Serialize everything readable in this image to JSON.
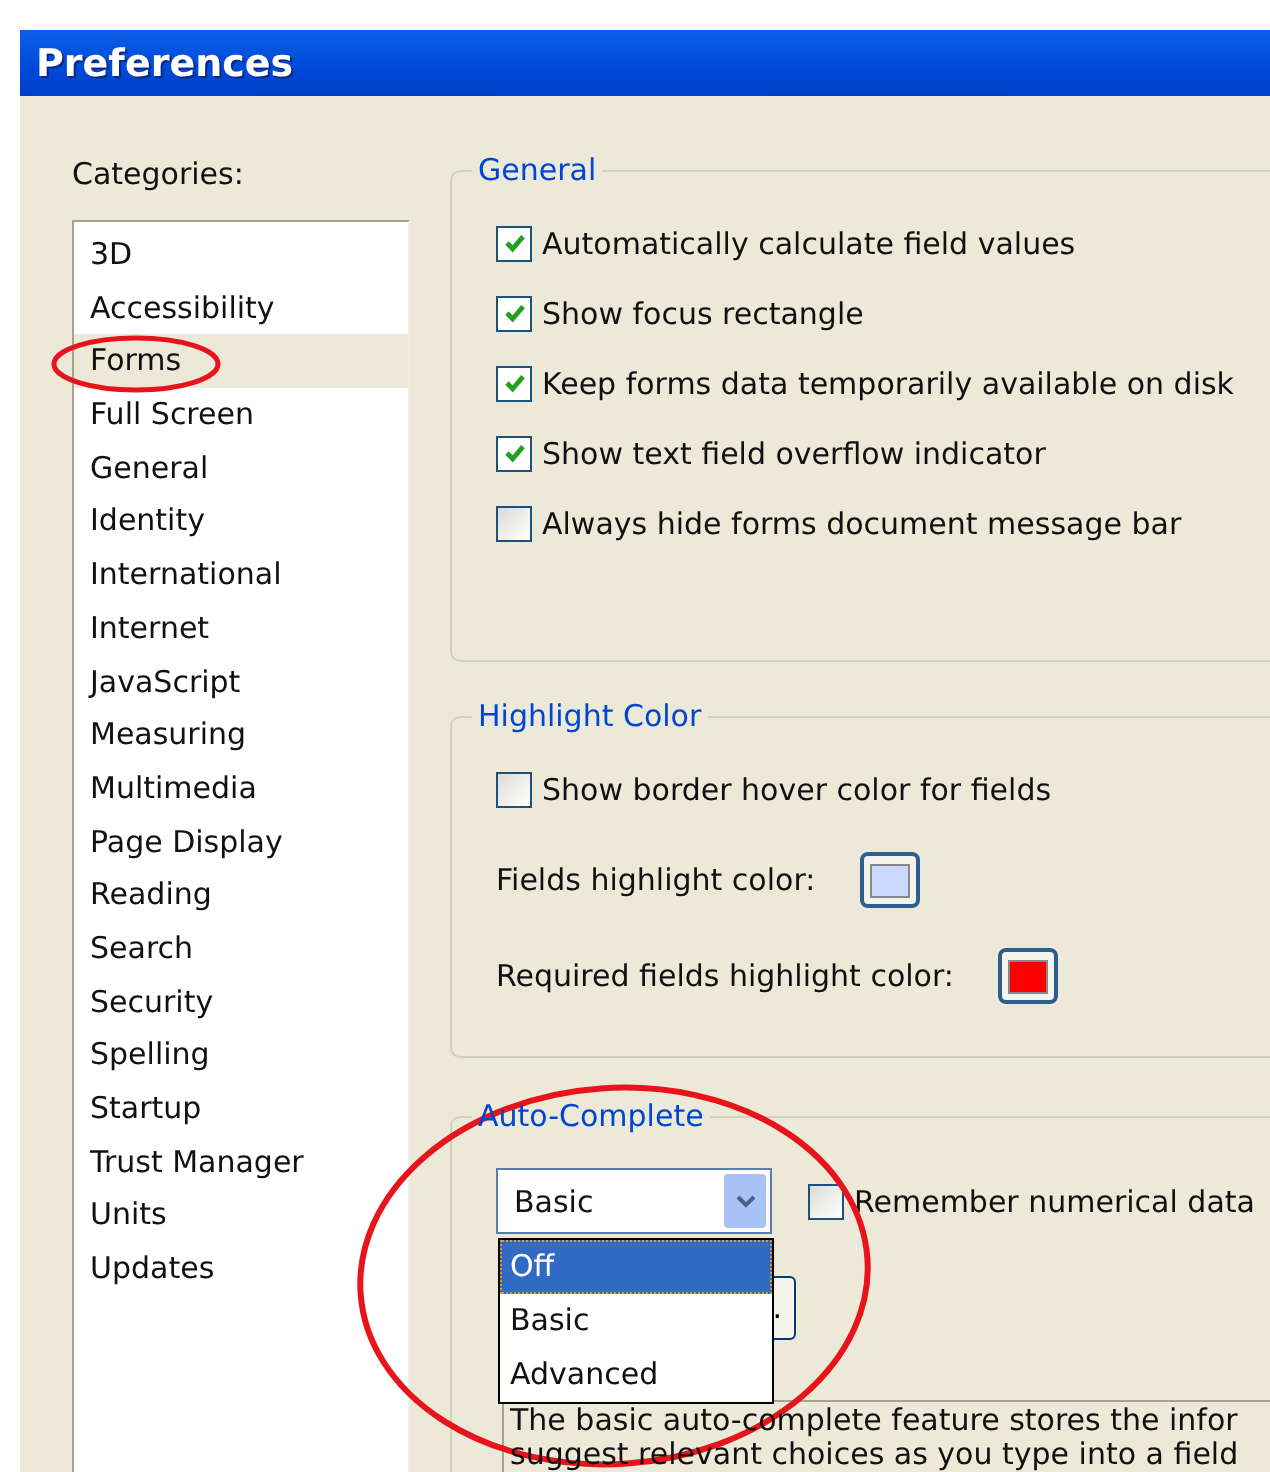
{
  "window": {
    "title": "Preferences"
  },
  "categories": {
    "label": "Categories:",
    "items": [
      {
        "label": "3D",
        "selected": false
      },
      {
        "label": "Accessibility",
        "selected": false
      },
      {
        "label": "Forms",
        "selected": true
      },
      {
        "label": "Full Screen",
        "selected": false
      },
      {
        "label": "General",
        "selected": false
      },
      {
        "label": "Identity",
        "selected": false
      },
      {
        "label": "International",
        "selected": false
      },
      {
        "label": "Internet",
        "selected": false
      },
      {
        "label": "JavaScript",
        "selected": false
      },
      {
        "label": "Measuring",
        "selected": false
      },
      {
        "label": "Multimedia",
        "selected": false
      },
      {
        "label": "Page Display",
        "selected": false
      },
      {
        "label": "Reading",
        "selected": false
      },
      {
        "label": "Search",
        "selected": false
      },
      {
        "label": "Security",
        "selected": false
      },
      {
        "label": "Spelling",
        "selected": false
      },
      {
        "label": "Startup",
        "selected": false
      },
      {
        "label": "Trust Manager",
        "selected": false
      },
      {
        "label": "Units",
        "selected": false
      },
      {
        "label": "Updates",
        "selected": false
      }
    ]
  },
  "groups": [
    {
      "kind": "checklist",
      "title": "General",
      "items": [
        {
          "label": "Automatically calculate field values",
          "checked": true
        },
        {
          "label": "Show focus rectangle",
          "checked": true
        },
        {
          "label": "Keep forms data temporarily available on disk",
          "checked": true
        },
        {
          "label": "Show text field overflow indicator",
          "checked": true
        },
        {
          "label": "Always hide forms document message bar",
          "checked": false
        }
      ]
    },
    {
      "kind": "highlight",
      "title": "Highlight Color",
      "checkbox": {
        "label": "Show border hover color for fields",
        "checked": false
      },
      "colors": [
        {
          "label": "Fields highlight color:",
          "color": "#ccd9ff"
        },
        {
          "label": "Required fields highlight color:",
          "color": "#ff0000"
        }
      ]
    },
    {
      "kind": "autocomplete",
      "title": "Auto-Complete",
      "dropdown": {
        "value": "Basic",
        "expanded": true,
        "options": [
          {
            "label": "Off",
            "highlighted": true
          },
          {
            "label": "Basic",
            "highlighted": false
          },
          {
            "label": "Advanced",
            "highlighted": false
          }
        ]
      },
      "checkbox": {
        "label": "Remember numerical data",
        "checked": false
      },
      "button": {
        "label": "."
      },
      "description": [
        "The basic auto-complete feature stores the infor",
        "suggest relevant choices as you type into a field"
      ]
    }
  ]
}
